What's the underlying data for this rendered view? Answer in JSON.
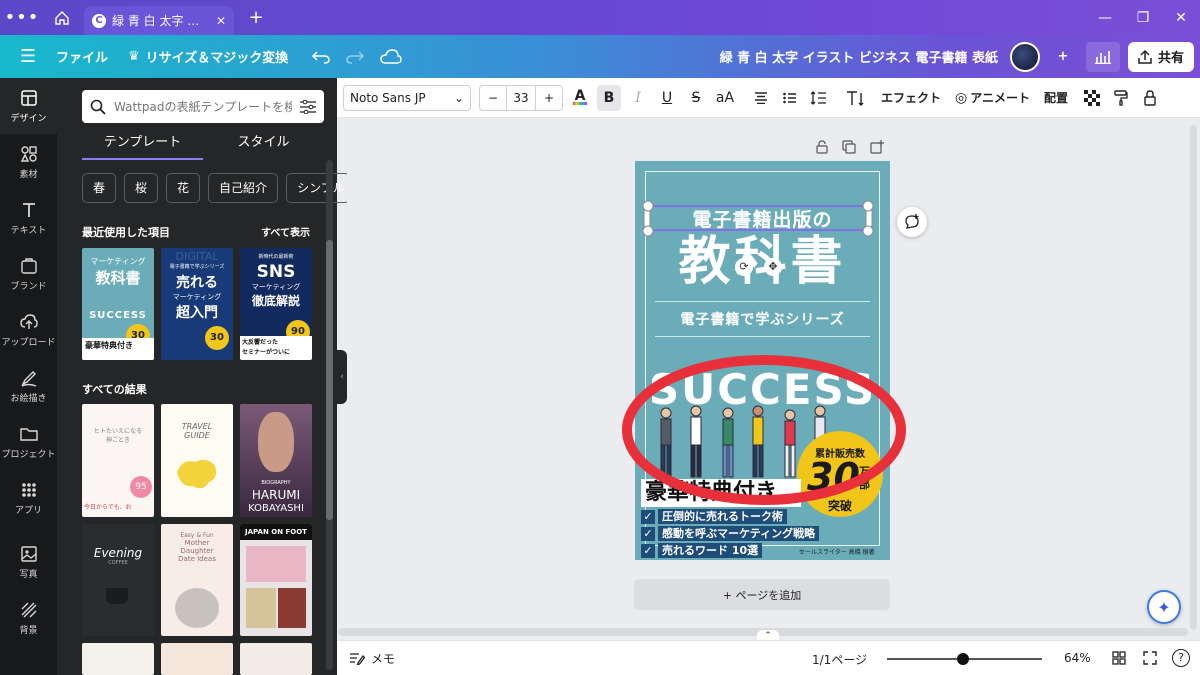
{
  "browser": {
    "tab_title": "緑 青 白 太字 …",
    "tab_favicon": "C"
  },
  "header": {
    "file": "ファイル",
    "resize": "リサイズ＆マジック変換",
    "title": "緑 青 白 太字 イラスト ビジネス 電子書籍 表紙",
    "share": "共有"
  },
  "rail": [
    {
      "label": "デザイン",
      "icon": "layout-icon"
    },
    {
      "label": "素材",
      "icon": "shapes-icon"
    },
    {
      "label": "テキスト",
      "icon": "text-icon"
    },
    {
      "label": "ブランド",
      "icon": "brand-icon"
    },
    {
      "label": "アップロード",
      "icon": "upload-icon"
    },
    {
      "label": "お絵描き",
      "icon": "draw-icon"
    },
    {
      "label": "プロジェクト",
      "icon": "folder-icon"
    },
    {
      "label": "アプリ",
      "icon": "apps-icon"
    },
    {
      "label": "写真",
      "icon": "photo-icon"
    },
    {
      "label": "背景",
      "icon": "background-icon"
    }
  ],
  "panel": {
    "search_placeholder": "Wattpadの表紙テンプレートを検索",
    "tab_templates": "テンプレート",
    "tab_styles": "スタイル",
    "chips": [
      "春",
      "桜",
      "花",
      "自己紹介",
      "シンプル"
    ],
    "recent_heading": "最近使用した項目",
    "see_all": "すべて表示",
    "all_results": "すべての結果",
    "recent": [
      {
        "t1": "マーケティング",
        "t2": "教科書",
        "t3": "SUCCESS",
        "t4": "豪華特典付き",
        "badge": "30"
      },
      {
        "t1": "電子書籍で学ぶシリーズ",
        "t2": "売れる",
        "t3": "マーケティング",
        "t4": "超入門",
        "t0": "DIGITAL",
        "badge": "30"
      },
      {
        "t1": "新時代の最新術",
        "t2": "SNS",
        "t3": "マーケティング",
        "t4": "徹底解説",
        "t5": "大反響だった",
        "t6": "セミナーがついに",
        "badge": "90"
      }
    ],
    "results": [
      {
        "t1": "ヒトたいえになる",
        "t2": "神ごとき",
        "t3": "今日からでも、お",
        "badge": "95"
      },
      {
        "t1": "TRAVEL",
        "t2": "GUIDE"
      },
      {
        "t1": "BIOGRAPHY",
        "t2": "HARUMI",
        "t3": "KOBAYASHI"
      },
      {
        "t1": "Evening",
        "t2": "COFFEE"
      },
      {
        "t1": "Easy & Fun",
        "t2": "Mother",
        "t3": "Daughter",
        "t4": "Date Ideas"
      },
      {
        "t1": "JAPAN ON FOOT"
      }
    ]
  },
  "toolbar": {
    "font": "Noto Sans JP",
    "size": "33",
    "effects": "エフェクト",
    "animate": "アニメート",
    "position": "配置"
  },
  "cover": {
    "title_small": "電子書籍出版の",
    "title_big": "教科書",
    "series": "電子書籍で学ぶシリーズ",
    "success": "SUCCESS",
    "bonus": "豪華特典付き",
    "badge_top": "累計販売数",
    "badge_num": "30",
    "badge_unit": "万部",
    "badge_bottom": "突破",
    "bullets": [
      "圧倒的に売れるトーク術",
      "感動を呼ぶマーケティング戦略",
      "売れるワード 10選"
    ],
    "author": "セールスライター 高橋 樹著",
    "colors": {
      "bg": "#6aacb8",
      "navy": "#1f4d7a",
      "gold": "#f2c619",
      "red": "#e8303a"
    }
  },
  "canvas": {
    "add_page": "+ ページを追加"
  },
  "bottom": {
    "notes": "メモ",
    "pages": "1/1ページ",
    "zoom": "64%"
  }
}
